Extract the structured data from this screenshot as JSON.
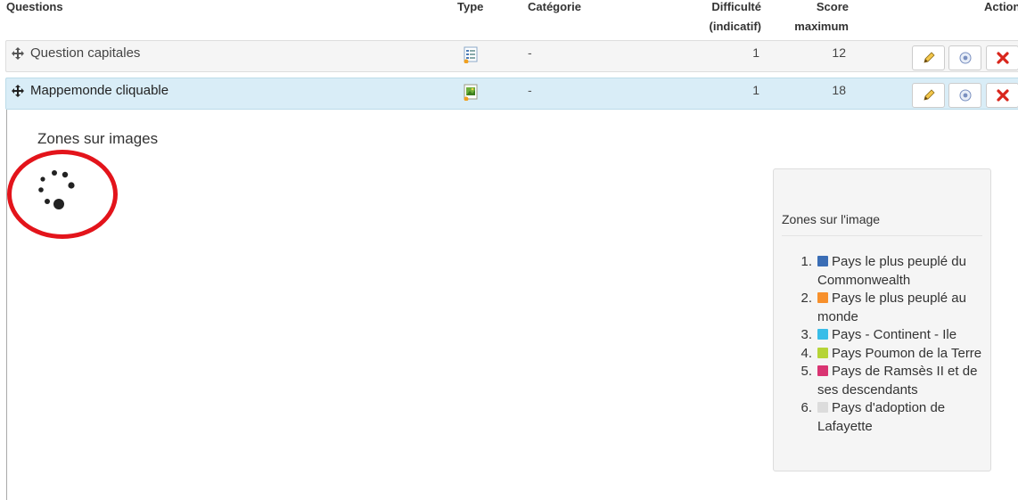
{
  "columns": {
    "questions": "Questions",
    "type": "Type",
    "category": "Catégorie",
    "difficulty_1": "Difficulté",
    "difficulty_2": "(indicatif)",
    "score_1": "Score",
    "score_2": "maximum",
    "actions": "Action"
  },
  "rows": [
    {
      "title": "Question capitales",
      "type_icon": "list-icon",
      "category": "-",
      "difficulty": "1",
      "score": "12"
    },
    {
      "title": "Mappemonde cliquable",
      "type_icon": "image-icon",
      "category": "-",
      "difficulty": "1",
      "score": "18"
    }
  ],
  "expanded": {
    "section_title": "Zones sur images",
    "panel_title": "Zones sur l'image",
    "zones": [
      {
        "num": "1.",
        "color": "#3a6db5",
        "label": "Pays le plus peuplé du Commonwealth"
      },
      {
        "num": "2.",
        "color": "#f7902c",
        "label": "Pays le plus peuplé au monde"
      },
      {
        "num": "3.",
        "color": "#39bde8",
        "label": "Pays - Continent - Ile"
      },
      {
        "num": "4.",
        "color": "#b6d437",
        "label": "Pays Poumon de la Terre"
      },
      {
        "num": "5.",
        "color": "#d93472",
        "label": "Pays de Ramsès II et de ses descendants"
      },
      {
        "num": "6.",
        "color": "#dcdcdc",
        "label": "Pays d'adoption de Lafayette"
      }
    ]
  },
  "colors": {
    "highlight_row": "#d9edf7",
    "annotation": "#e3141b",
    "delete": "#d9261c"
  }
}
